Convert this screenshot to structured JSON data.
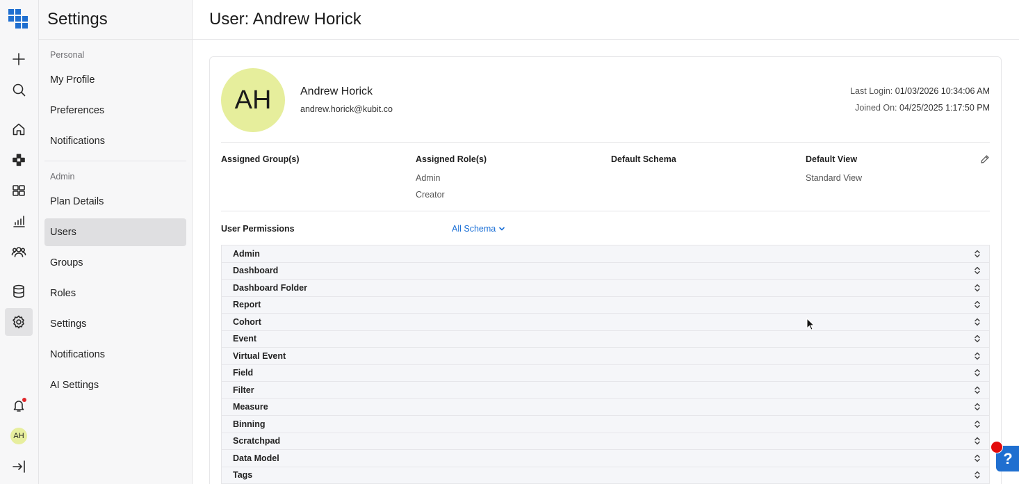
{
  "app": {
    "brand_color": "#1f6fd0",
    "accent_avatar_color": "#e6ee9c"
  },
  "rail": {
    "icons": [
      "logo-icon",
      "plus-icon",
      "search-icon",
      "home-icon",
      "apps-icon",
      "dashboard-icon",
      "chart-icon",
      "users-icon",
      "database-icon",
      "gear-icon",
      "bell-icon"
    ],
    "avatar_initials": "AH"
  },
  "sidebar": {
    "title": "Settings",
    "personal_label": "Personal",
    "personal_items": [
      "My Profile",
      "Preferences",
      "Notifications"
    ],
    "admin_label": "Admin",
    "admin_items": [
      "Plan Details",
      "Users",
      "Groups",
      "Roles",
      "Settings",
      "Notifications",
      "AI Settings"
    ],
    "active_item": "Users"
  },
  "main": {
    "title": "User: Andrew Horick",
    "user": {
      "initials": "AH",
      "name": "Andrew Horick",
      "email": "andrew.horick@kubit.co",
      "last_login_label": "Last Login:",
      "last_login": "01/03/2026 10:34:06 AM",
      "joined_label": "Joined On:",
      "joined": "04/25/2025 1:17:50 PM"
    },
    "info": {
      "groups_head": "Assigned Group(s)",
      "roles_head": "Assigned Role(s)",
      "roles": [
        "Admin",
        "Creator"
      ],
      "schema_head": "Default Schema",
      "view_head": "Default View",
      "view_value": "Standard View"
    },
    "permissions": {
      "label": "User Permissions",
      "schema_dropdown": "All Schema",
      "rows": [
        "Admin",
        "Dashboard",
        "Dashboard Folder",
        "Report",
        "Cohort",
        "Event",
        "Virtual Event",
        "Field",
        "Filter",
        "Measure",
        "Binning",
        "Scratchpad",
        "Data Model",
        "Tags"
      ]
    }
  },
  "help": {
    "label": "?"
  }
}
